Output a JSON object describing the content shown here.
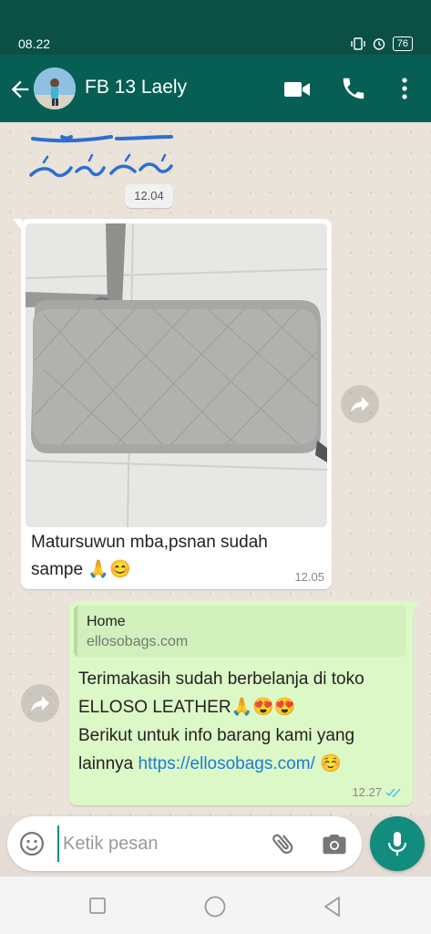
{
  "status_bar": {
    "time": "08.22",
    "battery": "76"
  },
  "header": {
    "contact_name": "FB 13 Laely"
  },
  "chat": {
    "date_chip": "12.04",
    "incoming": {
      "text": "Matursuwun mba,psnan sudah sampe 🙏😊",
      "time": "12.05"
    },
    "outgoing": {
      "preview_title": "Home",
      "preview_domain": "ellosobags.com",
      "line1": "Terimakasih sudah berbelanja di toko ELLOSO LEATHER🙏😍😍",
      "line2": "Berikut untuk info barang kami yang lainnya",
      "link": "https://ellosobags.com/",
      "emoji": "☺️",
      "time": "12.27"
    }
  },
  "input": {
    "placeholder": "Ketik pesan"
  },
  "colors": {
    "header": "#075e54",
    "status": "#0b4f45",
    "outgoing_bubble": "#dcf8c6",
    "accent": "#128c7e",
    "link": "#1a7bd8",
    "read_ticks": "#4fc3f7"
  }
}
